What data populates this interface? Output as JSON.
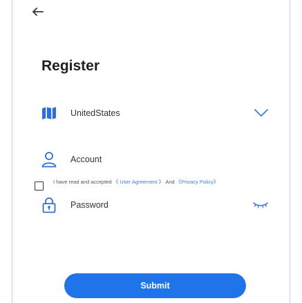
{
  "header": {
    "back_icon": "arrow-left-icon"
  },
  "page": {
    "title": "Register"
  },
  "country": {
    "icon": "map-icon",
    "value": "UnitedStates",
    "dropdown_icon": "chevron-down-icon"
  },
  "account": {
    "icon": "user-icon",
    "placeholder": "Account"
  },
  "password": {
    "icon": "lock-icon",
    "placeholder": "Password",
    "toggle_icon": "eye-closed-icon"
  },
  "terms": {
    "prefix": "I have read and accepted",
    "user_agreement": "《 User Agreement 》",
    "and": "And",
    "privacy_policy": "《Privacy Policy》"
  },
  "actions": {
    "submit_label": "Submit"
  },
  "colors": {
    "accent": "#1e74e8",
    "link": "#3a7de0",
    "icon": "#2f6fd6"
  }
}
